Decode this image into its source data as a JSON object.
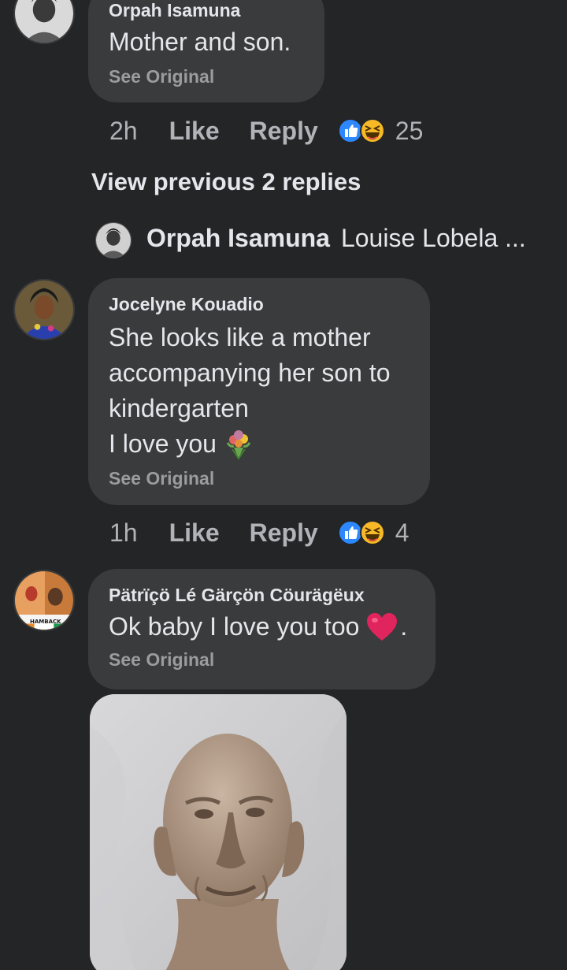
{
  "comments": [
    {
      "author": "Orpah Isamuna",
      "lines": [
        "Mother and son."
      ],
      "see_original": "See Original",
      "time": "2h",
      "like": "Like",
      "reply": "Reply",
      "reaction_count": "25",
      "reactions": [
        "like-icon",
        "haha-icon"
      ]
    },
    {
      "author": "Jocelyne Kouadio",
      "lines": [
        "She looks like a mother",
        "accompanying her son to",
        "kindergarten",
        "I love you"
      ],
      "emoji": "bouquet-icon",
      "see_original": "See Original",
      "time": "1h",
      "like": "Like",
      "reply": "Reply",
      "reaction_count": "4",
      "reactions": [
        "like-icon",
        "haha-icon"
      ]
    },
    {
      "author": "Pätrïçö Lé Gärçön Cöurägëux",
      "lines": [
        "Ok baby I love you too"
      ],
      "emoji": "red-heart-icon",
      "trailing": ".",
      "see_original": "See Original",
      "avatar_text": "HAMBACK"
    }
  ],
  "view_previous": "View previous 2 replies",
  "reply_preview": {
    "author": "Orpah Isamuna",
    "text": "Louise Lobela ..."
  },
  "colors": {
    "background": "#242526",
    "bubble": "#3a3b3c",
    "primary_text": "#e4e6eb",
    "secondary_text": "#b0b3b8",
    "like_blue": "#2d88ff",
    "haha_yellow": "#f7b928"
  }
}
